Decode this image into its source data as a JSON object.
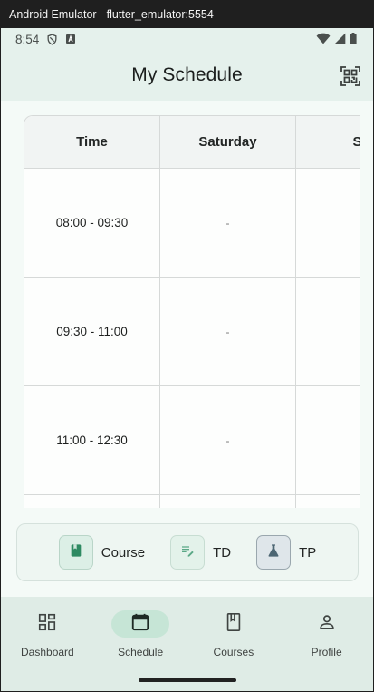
{
  "window": {
    "title": "Android Emulator - flutter_emulator:5554"
  },
  "statusbar": {
    "time": "8:54"
  },
  "appbar": {
    "title": "My Schedule"
  },
  "table": {
    "headers": [
      "Time",
      "Saturday",
      "Sur"
    ],
    "rows": [
      {
        "time": "08:00 - 09:30",
        "saturday": "-",
        "sunday": ""
      },
      {
        "time": "09:30 - 11:00",
        "saturday": "-",
        "sunday": ""
      },
      {
        "time": "11:00 - 12:30",
        "saturday": "-",
        "sunday": ""
      },
      {
        "time": "",
        "saturday": "",
        "sunday": ""
      }
    ]
  },
  "legend": {
    "course": {
      "label": "Course",
      "color": "#dcefe6"
    },
    "td": {
      "label": "TD",
      "color": "#e3f2ea"
    },
    "tp": {
      "label": "TP",
      "color": "#dfe6ea"
    }
  },
  "bottomnav": {
    "items": [
      {
        "label": "Dashboard",
        "icon": "dashboard-icon"
      },
      {
        "label": "Schedule",
        "icon": "calendar-icon",
        "active": true
      },
      {
        "label": "Courses",
        "icon": "book-icon"
      },
      {
        "label": "Profile",
        "icon": "person-icon"
      }
    ]
  },
  "colors": {
    "accent": "#c6e5d6",
    "appbar": "#e5f1ec",
    "navbar": "#dfece6"
  }
}
